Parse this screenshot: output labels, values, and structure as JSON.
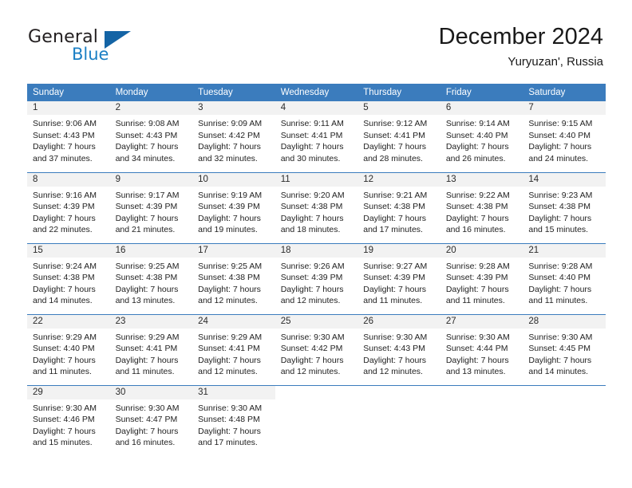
{
  "brand": {
    "name_top": "General",
    "name_bottom": "Blue",
    "accent_color": "#1464a5",
    "text_color": "#231f20"
  },
  "header": {
    "title": "December 2024",
    "subtitle": "Yuryuzan', Russia"
  },
  "theme": {
    "header_blue": "#3b7cbd",
    "daynum_band": "#f2f2f2",
    "text": "#222222"
  },
  "weekday_headers": [
    "Sunday",
    "Monday",
    "Tuesday",
    "Wednesday",
    "Thursday",
    "Friday",
    "Saturday"
  ],
  "weeks": [
    [
      {
        "day": "1",
        "lines": [
          "Sunrise: 9:06 AM",
          "Sunset: 4:43 PM",
          "Daylight: 7 hours",
          "and 37 minutes."
        ]
      },
      {
        "day": "2",
        "lines": [
          "Sunrise: 9:08 AM",
          "Sunset: 4:43 PM",
          "Daylight: 7 hours",
          "and 34 minutes."
        ]
      },
      {
        "day": "3",
        "lines": [
          "Sunrise: 9:09 AM",
          "Sunset: 4:42 PM",
          "Daylight: 7 hours",
          "and 32 minutes."
        ]
      },
      {
        "day": "4",
        "lines": [
          "Sunrise: 9:11 AM",
          "Sunset: 4:41 PM",
          "Daylight: 7 hours",
          "and 30 minutes."
        ]
      },
      {
        "day": "5",
        "lines": [
          "Sunrise: 9:12 AM",
          "Sunset: 4:41 PM",
          "Daylight: 7 hours",
          "and 28 minutes."
        ]
      },
      {
        "day": "6",
        "lines": [
          "Sunrise: 9:14 AM",
          "Sunset: 4:40 PM",
          "Daylight: 7 hours",
          "and 26 minutes."
        ]
      },
      {
        "day": "7",
        "lines": [
          "Sunrise: 9:15 AM",
          "Sunset: 4:40 PM",
          "Daylight: 7 hours",
          "and 24 minutes."
        ]
      }
    ],
    [
      {
        "day": "8",
        "lines": [
          "Sunrise: 9:16 AM",
          "Sunset: 4:39 PM",
          "Daylight: 7 hours",
          "and 22 minutes."
        ]
      },
      {
        "day": "9",
        "lines": [
          "Sunrise: 9:17 AM",
          "Sunset: 4:39 PM",
          "Daylight: 7 hours",
          "and 21 minutes."
        ]
      },
      {
        "day": "10",
        "lines": [
          "Sunrise: 9:19 AM",
          "Sunset: 4:39 PM",
          "Daylight: 7 hours",
          "and 19 minutes."
        ]
      },
      {
        "day": "11",
        "lines": [
          "Sunrise: 9:20 AM",
          "Sunset: 4:38 PM",
          "Daylight: 7 hours",
          "and 18 minutes."
        ]
      },
      {
        "day": "12",
        "lines": [
          "Sunrise: 9:21 AM",
          "Sunset: 4:38 PM",
          "Daylight: 7 hours",
          "and 17 minutes."
        ]
      },
      {
        "day": "13",
        "lines": [
          "Sunrise: 9:22 AM",
          "Sunset: 4:38 PM",
          "Daylight: 7 hours",
          "and 16 minutes."
        ]
      },
      {
        "day": "14",
        "lines": [
          "Sunrise: 9:23 AM",
          "Sunset: 4:38 PM",
          "Daylight: 7 hours",
          "and 15 minutes."
        ]
      }
    ],
    [
      {
        "day": "15",
        "lines": [
          "Sunrise: 9:24 AM",
          "Sunset: 4:38 PM",
          "Daylight: 7 hours",
          "and 14 minutes."
        ]
      },
      {
        "day": "16",
        "lines": [
          "Sunrise: 9:25 AM",
          "Sunset: 4:38 PM",
          "Daylight: 7 hours",
          "and 13 minutes."
        ]
      },
      {
        "day": "17",
        "lines": [
          "Sunrise: 9:25 AM",
          "Sunset: 4:38 PM",
          "Daylight: 7 hours",
          "and 12 minutes."
        ]
      },
      {
        "day": "18",
        "lines": [
          "Sunrise: 9:26 AM",
          "Sunset: 4:39 PM",
          "Daylight: 7 hours",
          "and 12 minutes."
        ]
      },
      {
        "day": "19",
        "lines": [
          "Sunrise: 9:27 AM",
          "Sunset: 4:39 PM",
          "Daylight: 7 hours",
          "and 11 minutes."
        ]
      },
      {
        "day": "20",
        "lines": [
          "Sunrise: 9:28 AM",
          "Sunset: 4:39 PM",
          "Daylight: 7 hours",
          "and 11 minutes."
        ]
      },
      {
        "day": "21",
        "lines": [
          "Sunrise: 9:28 AM",
          "Sunset: 4:40 PM",
          "Daylight: 7 hours",
          "and 11 minutes."
        ]
      }
    ],
    [
      {
        "day": "22",
        "lines": [
          "Sunrise: 9:29 AM",
          "Sunset: 4:40 PM",
          "Daylight: 7 hours",
          "and 11 minutes."
        ]
      },
      {
        "day": "23",
        "lines": [
          "Sunrise: 9:29 AM",
          "Sunset: 4:41 PM",
          "Daylight: 7 hours",
          "and 11 minutes."
        ]
      },
      {
        "day": "24",
        "lines": [
          "Sunrise: 9:29 AM",
          "Sunset: 4:41 PM",
          "Daylight: 7 hours",
          "and 12 minutes."
        ]
      },
      {
        "day": "25",
        "lines": [
          "Sunrise: 9:30 AM",
          "Sunset: 4:42 PM",
          "Daylight: 7 hours",
          "and 12 minutes."
        ]
      },
      {
        "day": "26",
        "lines": [
          "Sunrise: 9:30 AM",
          "Sunset: 4:43 PM",
          "Daylight: 7 hours",
          "and 12 minutes."
        ]
      },
      {
        "day": "27",
        "lines": [
          "Sunrise: 9:30 AM",
          "Sunset: 4:44 PM",
          "Daylight: 7 hours",
          "and 13 minutes."
        ]
      },
      {
        "day": "28",
        "lines": [
          "Sunrise: 9:30 AM",
          "Sunset: 4:45 PM",
          "Daylight: 7 hours",
          "and 14 minutes."
        ]
      }
    ],
    [
      {
        "day": "29",
        "lines": [
          "Sunrise: 9:30 AM",
          "Sunset: 4:46 PM",
          "Daylight: 7 hours",
          "and 15 minutes."
        ]
      },
      {
        "day": "30",
        "lines": [
          "Sunrise: 9:30 AM",
          "Sunset: 4:47 PM",
          "Daylight: 7 hours",
          "and 16 minutes."
        ]
      },
      {
        "day": "31",
        "lines": [
          "Sunrise: 9:30 AM",
          "Sunset: 4:48 PM",
          "Daylight: 7 hours",
          "and 17 minutes."
        ]
      },
      {
        "day": "",
        "lines": []
      },
      {
        "day": "",
        "lines": []
      },
      {
        "day": "",
        "lines": []
      },
      {
        "day": "",
        "lines": []
      }
    ]
  ]
}
